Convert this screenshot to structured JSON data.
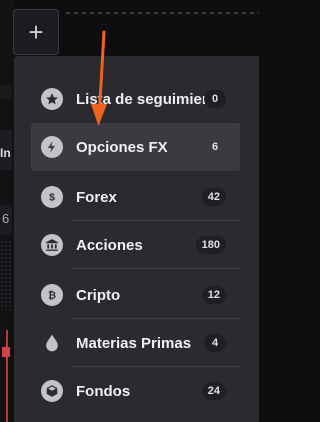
{
  "add_button": {
    "label": "+"
  },
  "background": {
    "fragment_a": "In",
    "fragment_b": "6"
  },
  "menu": {
    "items": [
      {
        "label": "Lista de seguimiento",
        "count": "0",
        "icon": "star-icon"
      },
      {
        "label": "Opciones FX",
        "count": "6",
        "icon": "bolt-icon",
        "active": true
      },
      {
        "label": "Forex",
        "count": "42",
        "icon": "dollar-icon"
      },
      {
        "label": "Acciones",
        "count": "180",
        "icon": "bank-icon"
      },
      {
        "label": "Cripto",
        "count": "12",
        "icon": "bitcoin-icon"
      },
      {
        "label": "Materias Primas",
        "count": "4",
        "icon": "drop-icon"
      },
      {
        "label": "Fondos",
        "count": "24",
        "icon": "box-icon"
      }
    ]
  },
  "colors": {
    "panel": "#2a2a2f",
    "active_row": "#3a3a41",
    "arrow": "#f0621e",
    "badge_bg": "#1f1f23"
  }
}
